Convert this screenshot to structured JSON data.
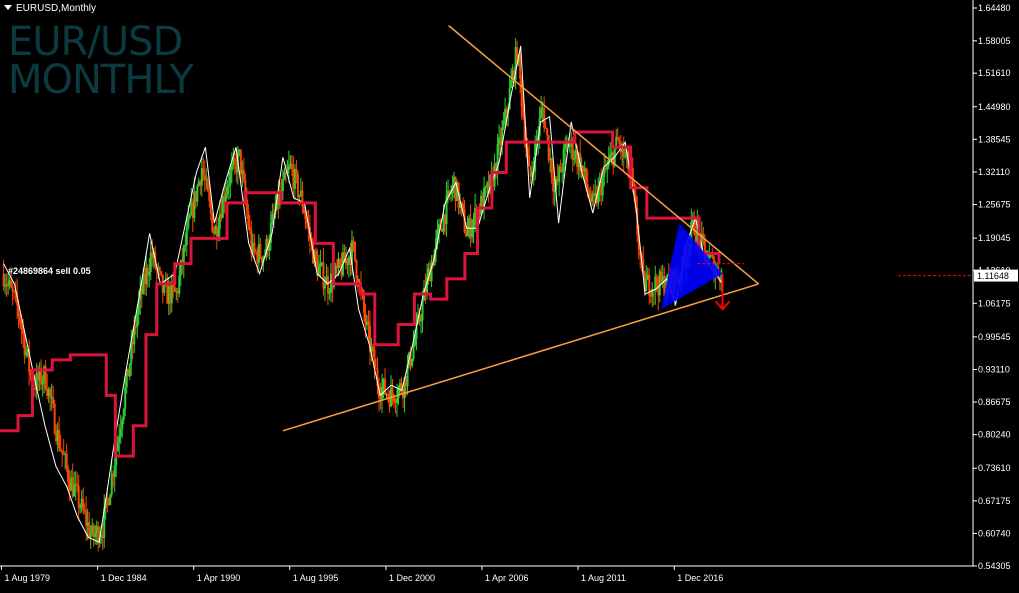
{
  "header": {
    "symbol_timeframe": "EURUSD,Monthly"
  },
  "watermark": {
    "line1": "EUR/USD",
    "line2": "MONTHLY"
  },
  "trade_label": "#24869864 sell 0.05",
  "colors": {
    "background": "#000000",
    "axis": "#ffffff",
    "bull_candle": "#32cd32",
    "bear_candle": "#ff4500",
    "close_line": "#ffffff",
    "step_line": "#dc143c",
    "trendline": "#ffa040",
    "pattern_fill": "#0000ff",
    "arrow": "#ff0000",
    "price_marker": "#ff0000"
  },
  "chart_data": {
    "type": "line",
    "title": "EURUSD,Monthly",
    "x_tick_labels": [
      "1 Aug 1979",
      "1 Dec 1984",
      "1 Apr 1990",
      "1 Aug 1995",
      "1 Dec 2000",
      "1 Apr 2006",
      "1 Aug 2011",
      "1 Dec 2016"
    ],
    "y_tick_labels": [
      "1.64480",
      "1.58005",
      "1.51610",
      "1.44980",
      "1.38545",
      "1.32110",
      "1.25675",
      "1.19045",
      "1.12610",
      "1.06175",
      "0.99545",
      "0.93110",
      "0.86675",
      "0.80240",
      "0.73610",
      "0.67175",
      "0.60740",
      "0.54305"
    ],
    "ylim": [
      0.54305,
      1.6448
    ],
    "xlim": [
      1979.5,
      2033.5
    ],
    "grid": false,
    "current_price": "1.11648",
    "series": [
      {
        "style": "close-line",
        "points": [
          [
            1979.7,
            1.14
          ],
          [
            1980.3,
            1.1
          ],
          [
            1980.9,
            1.0
          ],
          [
            1981.5,
            0.9
          ],
          [
            1982.0,
            0.82
          ],
          [
            1982.6,
            0.74
          ],
          [
            1983.2,
            0.7
          ],
          [
            1983.8,
            0.64
          ],
          [
            1984.4,
            0.6
          ],
          [
            1985.0,
            0.59
          ],
          [
            1985.4,
            0.68
          ],
          [
            1985.9,
            0.8
          ],
          [
            1986.5,
            0.93
          ],
          [
            1987.2,
            1.07
          ],
          [
            1987.8,
            1.2
          ],
          [
            1988.4,
            1.1
          ],
          [
            1989.2,
            1.12
          ],
          [
            1989.8,
            1.22
          ],
          [
            1990.4,
            1.32
          ],
          [
            1990.9,
            1.37
          ],
          [
            1991.4,
            1.22
          ],
          [
            1992.0,
            1.3
          ],
          [
            1992.6,
            1.37
          ],
          [
            1993.3,
            1.18
          ],
          [
            1993.9,
            1.12
          ],
          [
            1994.6,
            1.2
          ],
          [
            1995.2,
            1.35
          ],
          [
            1995.8,
            1.27
          ],
          [
            1996.4,
            1.26
          ],
          [
            1997.1,
            1.12
          ],
          [
            1997.7,
            1.1
          ],
          [
            1998.3,
            1.12
          ],
          [
            1998.9,
            1.17
          ],
          [
            1999.4,
            1.05
          ],
          [
            2000.0,
            0.98
          ],
          [
            2000.6,
            0.88
          ],
          [
            2001.2,
            0.9
          ],
          [
            2001.8,
            0.89
          ],
          [
            2002.4,
            0.98
          ],
          [
            2003.0,
            1.08
          ],
          [
            2003.6,
            1.15
          ],
          [
            2004.2,
            1.26
          ],
          [
            2004.8,
            1.3
          ],
          [
            2005.4,
            1.21
          ],
          [
            2006.0,
            1.21
          ],
          [
            2006.6,
            1.28
          ],
          [
            2007.2,
            1.34
          ],
          [
            2007.8,
            1.46
          ],
          [
            2008.4,
            1.57
          ],
          [
            2008.9,
            1.27
          ],
          [
            2009.5,
            1.42
          ],
          [
            2010.0,
            1.43
          ],
          [
            2010.5,
            1.22
          ],
          [
            2011.2,
            1.42
          ],
          [
            2011.8,
            1.32
          ],
          [
            2012.4,
            1.24
          ],
          [
            2013.0,
            1.33
          ],
          [
            2013.6,
            1.35
          ],
          [
            2014.2,
            1.38
          ],
          [
            2014.8,
            1.25
          ],
          [
            2015.3,
            1.08
          ],
          [
            2015.9,
            1.09
          ],
          [
            2016.5,
            1.11
          ],
          [
            2017.0,
            1.06
          ],
          [
            2017.6,
            1.18
          ],
          [
            2018.1,
            1.23
          ],
          [
            2018.6,
            1.15
          ],
          [
            2019.2,
            1.12
          ],
          [
            2019.6,
            1.1
          ]
        ]
      },
      {
        "style": "step-line",
        "points": [
          [
            1979.5,
            0.81
          ],
          [
            1980.5,
            0.84
          ],
          [
            1981.3,
            0.93
          ],
          [
            1982.4,
            0.95
          ],
          [
            1983.4,
            0.96
          ],
          [
            1984.3,
            0.96
          ],
          [
            1985.4,
            0.88
          ],
          [
            1985.9,
            0.76
          ],
          [
            1986.3,
            0.76
          ],
          [
            1986.9,
            0.82
          ],
          [
            1987.6,
            1.0
          ],
          [
            1988.2,
            1.1
          ],
          [
            1989.2,
            1.14
          ],
          [
            1990.1,
            1.19
          ],
          [
            1991.1,
            1.19
          ],
          [
            1992.1,
            1.26
          ],
          [
            1993.1,
            1.28
          ],
          [
            1994.2,
            1.28
          ],
          [
            1995.1,
            1.26
          ],
          [
            1996.1,
            1.26
          ],
          [
            1997.0,
            1.18
          ],
          [
            1998.0,
            1.1
          ],
          [
            1998.8,
            1.1
          ],
          [
            1999.5,
            1.08
          ],
          [
            2000.3,
            0.98
          ],
          [
            2000.9,
            0.98
          ],
          [
            2001.6,
            1.02
          ],
          [
            2002.5,
            1.08
          ],
          [
            2003.4,
            1.07
          ],
          [
            2004.3,
            1.11
          ],
          [
            2005.3,
            1.16
          ],
          [
            2006.0,
            1.25
          ],
          [
            2006.8,
            1.32
          ],
          [
            2007.6,
            1.38
          ],
          [
            2008.6,
            1.38
          ],
          [
            2009.4,
            1.38
          ],
          [
            2010.2,
            1.38
          ],
          [
            2011.4,
            1.4
          ],
          [
            2012.5,
            1.4
          ],
          [
            2013.5,
            1.37
          ],
          [
            2014.5,
            1.29
          ],
          [
            2015.4,
            1.23
          ],
          [
            2016.2,
            1.23
          ],
          [
            2017.5,
            1.23
          ],
          [
            2018.3,
            1.16
          ],
          [
            2019.4,
            1.14
          ]
        ]
      }
    ],
    "candle_path": [
      [
        1979.7,
        1.12
      ],
      [
        1980.5,
        1.05
      ],
      [
        1981.3,
        0.9
      ],
      [
        1982.0,
        0.92
      ],
      [
        1982.7,
        0.8
      ],
      [
        1983.3,
        0.72
      ],
      [
        1984.0,
        0.66
      ],
      [
        1984.6,
        0.6
      ],
      [
        1985.2,
        0.62
      ],
      [
        1985.8,
        0.74
      ],
      [
        1986.5,
        0.9
      ],
      [
        1987.2,
        1.06
      ],
      [
        1987.9,
        1.16
      ],
      [
        1988.6,
        1.08
      ],
      [
        1989.3,
        1.08
      ],
      [
        1990.0,
        1.22
      ],
      [
        1990.7,
        1.33
      ],
      [
        1991.4,
        1.2
      ],
      [
        1992.1,
        1.3
      ],
      [
        1992.8,
        1.35
      ],
      [
        1993.5,
        1.16
      ],
      [
        1994.2,
        1.16
      ],
      [
        1994.9,
        1.26
      ],
      [
        1995.6,
        1.33
      ],
      [
        1996.3,
        1.26
      ],
      [
        1997.0,
        1.14
      ],
      [
        1997.7,
        1.1
      ],
      [
        1998.4,
        1.13
      ],
      [
        1999.1,
        1.17
      ],
      [
        1999.8,
        1.02
      ],
      [
        2000.5,
        0.9
      ],
      [
        2001.2,
        0.88
      ],
      [
        2001.9,
        0.9
      ],
      [
        2002.6,
        1.0
      ],
      [
        2003.3,
        1.12
      ],
      [
        2004.0,
        1.22
      ],
      [
        2004.7,
        1.3
      ],
      [
        2005.4,
        1.2
      ],
      [
        2006.1,
        1.25
      ],
      [
        2006.8,
        1.3
      ],
      [
        2007.5,
        1.42
      ],
      [
        2008.2,
        1.56
      ],
      [
        2008.9,
        1.3
      ],
      [
        2009.6,
        1.45
      ],
      [
        2010.3,
        1.28
      ],
      [
        2011.0,
        1.38
      ],
      [
        2011.7,
        1.34
      ],
      [
        2012.4,
        1.25
      ],
      [
        2013.1,
        1.32
      ],
      [
        2013.8,
        1.38
      ],
      [
        2014.5,
        1.32
      ],
      [
        2015.2,
        1.1
      ],
      [
        2015.9,
        1.1
      ],
      [
        2016.6,
        1.1
      ],
      [
        2017.3,
        1.12
      ],
      [
        2018.0,
        1.22
      ],
      [
        2018.6,
        1.16
      ],
      [
        2019.2,
        1.13
      ],
      [
        2019.6,
        1.12
      ]
    ],
    "annotations": {
      "trendline_upper": [
        [
          2004.4,
          1.61
        ],
        [
          2021.6,
          1.1
        ]
      ],
      "trendline_lower": [
        [
          1995.2,
          0.81
        ],
        [
          2021.6,
          1.1
        ]
      ],
      "triangle_fill": [
        [
          2017.2,
          1.22
        ],
        [
          2016.2,
          1.05
        ],
        [
          2019.6,
          1.12
        ]
      ],
      "sell_arrow_x": 2019.6,
      "sell_arrow_y": [
        1.12,
        1.05
      ],
      "price_marker_dash": [
        [
          2018.2,
          1.14
        ],
        [
          2020.8,
          1.14
        ]
      ]
    }
  }
}
